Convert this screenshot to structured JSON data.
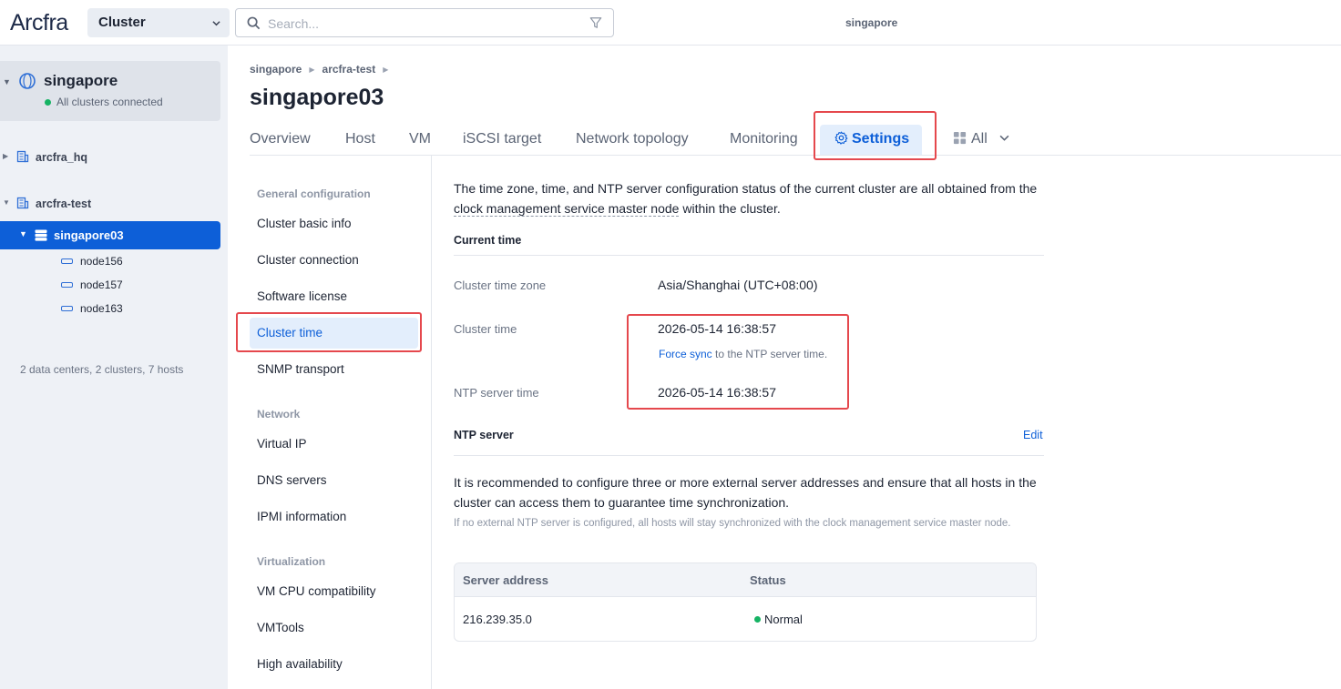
{
  "app": {
    "logo": "Arcfra",
    "scope": "Cluster",
    "search_placeholder": "Search...",
    "center_title": "singapore"
  },
  "sidebar": {
    "datacenter": {
      "name": "singapore",
      "status": "All clusters connected",
      "status_color": "#16b364"
    },
    "tree": [
      {
        "label": "arcfra_hq"
      },
      {
        "label": "arcfra-test"
      }
    ],
    "selected_cluster": "singapore03",
    "nodes": [
      "node156",
      "node157",
      "node163"
    ],
    "summary": "2 data centers, 2 clusters, 7 hosts"
  },
  "header": {
    "breadcrumb": [
      "singapore",
      "arcfra-test"
    ],
    "title": "singapore03",
    "tabs": [
      "Overview",
      "Host",
      "VM",
      "iSCSI target",
      "Network topology",
      "Monitoring",
      "Settings",
      "All"
    ],
    "active_tab": "Settings"
  },
  "settings_nav": {
    "groups": [
      {
        "title": "General configuration",
        "items": [
          "Cluster basic info",
          "Cluster connection",
          "Software license",
          "Cluster time",
          "SNMP transport"
        ]
      },
      {
        "title": "Network",
        "items": [
          "Virtual IP",
          "DNS servers",
          "IPMI information"
        ]
      },
      {
        "title": "Virtualization",
        "items": [
          "VM CPU compatibility",
          "VMTools",
          "High availability"
        ]
      }
    ],
    "active_item": "Cluster time"
  },
  "content": {
    "intro_before": "The time zone, time, and NTP server configuration status of the current cluster are all obtained from the ",
    "intro_link": "clock management service master node",
    "intro_after": " within the cluster.",
    "current_time_title": "Current time",
    "timezone_label": "Cluster time zone",
    "timezone_value": "Asia/Shanghai (UTC+08:00)",
    "cluster_time_label": "Cluster time",
    "cluster_time_value": "2026-05-14 16:38:57",
    "force_sync_link": "Force sync",
    "force_sync_text": " to the NTP server time.",
    "ntp_time_label": "NTP server time",
    "ntp_time_value": "2026-05-14 16:38:57",
    "ntp_title": "NTP server",
    "edit_label": "Edit",
    "ntp_recommend": "It is recommended to configure three or more external server addresses and ensure that all hosts in the cluster can access them to guarantee time synchronization.",
    "ntp_hint": "If no external NTP server is configured, all hosts will stay synchronized with the clock management service master node.",
    "table": {
      "columns": [
        "Server address",
        "Status"
      ],
      "rows": [
        {
          "address": "216.239.35.0",
          "status": "Normal",
          "status_color": "#16b364"
        }
      ]
    }
  },
  "colors": {
    "accent": "#0d5fd8",
    "highlight": "#e5484d"
  }
}
